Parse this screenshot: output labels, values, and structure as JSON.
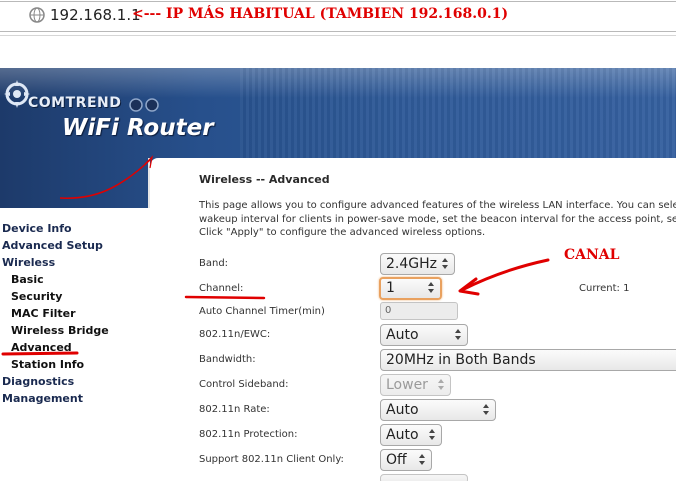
{
  "browser": {
    "url": "192.168.1.1",
    "annotation": "<--- IP MÁS HABITUAL (TAMBIEN 192.168.0.1)"
  },
  "header": {
    "brand": "COMTREND",
    "product": "WiFi Router"
  },
  "menu": {
    "items": [
      {
        "label": "Device Info"
      },
      {
        "label": "Advanced Setup"
      },
      {
        "label": "Wireless"
      },
      {
        "label": "Basic"
      },
      {
        "label": "Security"
      },
      {
        "label": "MAC Filter"
      },
      {
        "label": "Wireless Bridge"
      },
      {
        "label": "Advanced"
      },
      {
        "label": "Station Info"
      },
      {
        "label": "Diagnostics"
      },
      {
        "label": "Management"
      }
    ]
  },
  "content": {
    "title": "Wireless -- Advanced",
    "description": [
      "This page allows you to configure advanced features of the wireless LAN interface. You can selec",
      "wakeup interval for clients in power-save mode, set the beacon interval for the access point, set",
      "Click \"Apply\" to configure the advanced wireless options."
    ],
    "fields": {
      "band": {
        "label": "Band:",
        "value": "2.4GHz"
      },
      "channel": {
        "label": "Channel:",
        "value": "1",
        "current": "Current: 1"
      },
      "auto_channel_timer": {
        "label": "Auto Channel Timer(min)",
        "value": "0"
      },
      "ewc": {
        "label": "802.11n/EWC:",
        "value": "Auto"
      },
      "bandwidth": {
        "label": "Bandwidth:",
        "value": "20MHz in Both Bands"
      },
      "control_sideband": {
        "label": "Control Sideband:",
        "value": "Lower"
      },
      "n_rate": {
        "label": "802.11n Rate:",
        "value": "Auto"
      },
      "n_protection": {
        "label": "802.11n Protection:",
        "value": "Auto"
      },
      "n_client_only": {
        "label": "Support 802.11n Client Only:",
        "value": "Off"
      }
    }
  },
  "annotations": {
    "canal": "CANAL",
    "color": "#e00000"
  }
}
